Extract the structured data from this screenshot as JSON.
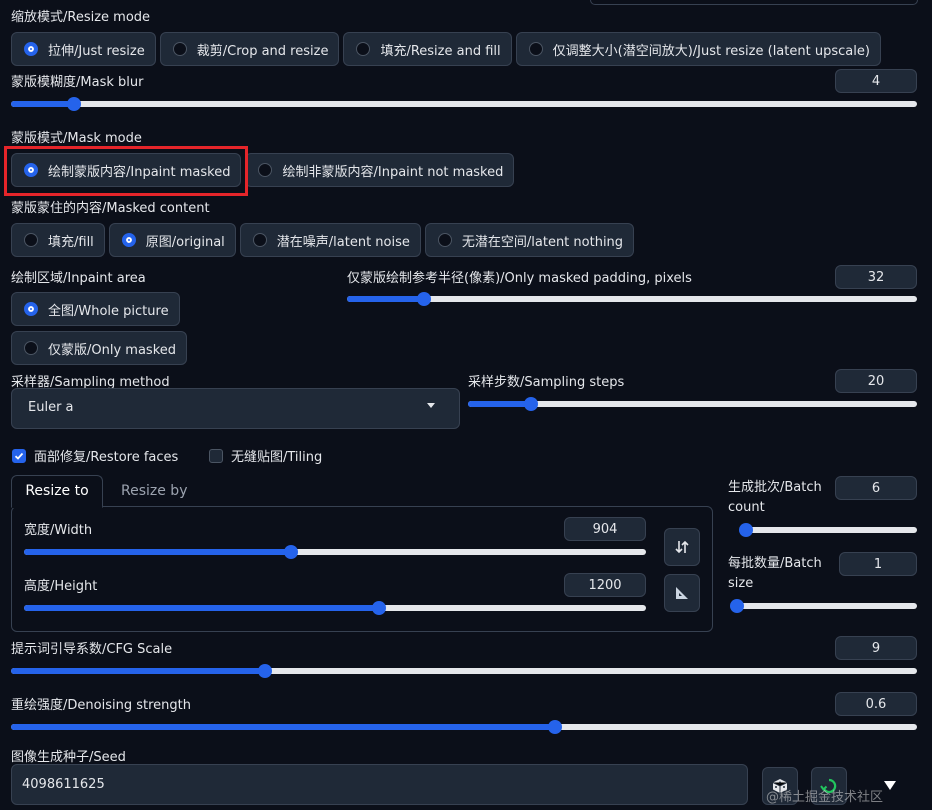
{
  "resize_mode": {
    "label": "缩放模式/Resize mode",
    "options": [
      "拉伸/Just resize",
      "裁剪/Crop and resize",
      "填充/Resize and fill",
      "仅调整大小(潜空间放大)/Just resize (latent upscale)"
    ],
    "selected": 0
  },
  "mask_blur": {
    "label": "蒙版模糊度/Mask blur",
    "value": "4",
    "fraction": 0.07
  },
  "mask_mode": {
    "label": "蒙版模式/Mask mode",
    "options": [
      "绘制蒙版内容/Inpaint masked",
      "绘制非蒙版内容/Inpaint not masked"
    ],
    "selected": 0
  },
  "masked_content": {
    "label": "蒙版蒙住的内容/Masked content",
    "options": [
      "填充/fill",
      "原图/original",
      "潜在噪声/latent noise",
      "无潜在空间/latent nothing"
    ],
    "selected": 1
  },
  "inpaint_area": {
    "label": "绘制区域/Inpaint area",
    "options": [
      "全图/Whole picture",
      "仅蒙版/Only masked"
    ],
    "selected": 0
  },
  "masked_padding": {
    "label": "仅蒙版绘制参考半径(像素)/Only masked padding, pixels",
    "value": "32",
    "fraction": 0.135
  },
  "sampler": {
    "label": "采样器/Sampling method",
    "value": "Euler a"
  },
  "steps": {
    "label": "采样步数/Sampling steps",
    "value": "20",
    "fraction": 0.14
  },
  "restore_faces": {
    "label": "面部修复/Restore faces",
    "checked": true
  },
  "tiling": {
    "label": "无缝贴图/Tiling",
    "checked": false
  },
  "resize_tabs": [
    "Resize to",
    "Resize by"
  ],
  "width": {
    "label": "宽度/Width",
    "value": "904",
    "fraction": 0.43
  },
  "height": {
    "label": "高度/Height",
    "value": "1200",
    "fraction": 0.57
  },
  "batch_count": {
    "label_1": "生成批次/Batch",
    "label_2": "count",
    "value": "6",
    "fraction": 0.03
  },
  "batch_size": {
    "label_1": "每批数量/Batch",
    "label_2": "size",
    "value": "1",
    "fraction": 0.0
  },
  "cfg": {
    "label": "提示词引导系数/CFG Scale",
    "value": "9",
    "fraction": 0.28
  },
  "denoise": {
    "label": "重绘强度/Denoising strength",
    "value": "0.6",
    "fraction": 0.6
  },
  "seed": {
    "label": "图像生成种子/Seed",
    "value": "4098611625"
  },
  "watermark": "@稀土掘金技术社区",
  "icons": {
    "swap": "swap-vertical-icon",
    "aspect": "ruler-triangle-icon",
    "random": "dice-icon",
    "reuse": "recycle-icon",
    "dropdown": "caret-down-icon"
  }
}
